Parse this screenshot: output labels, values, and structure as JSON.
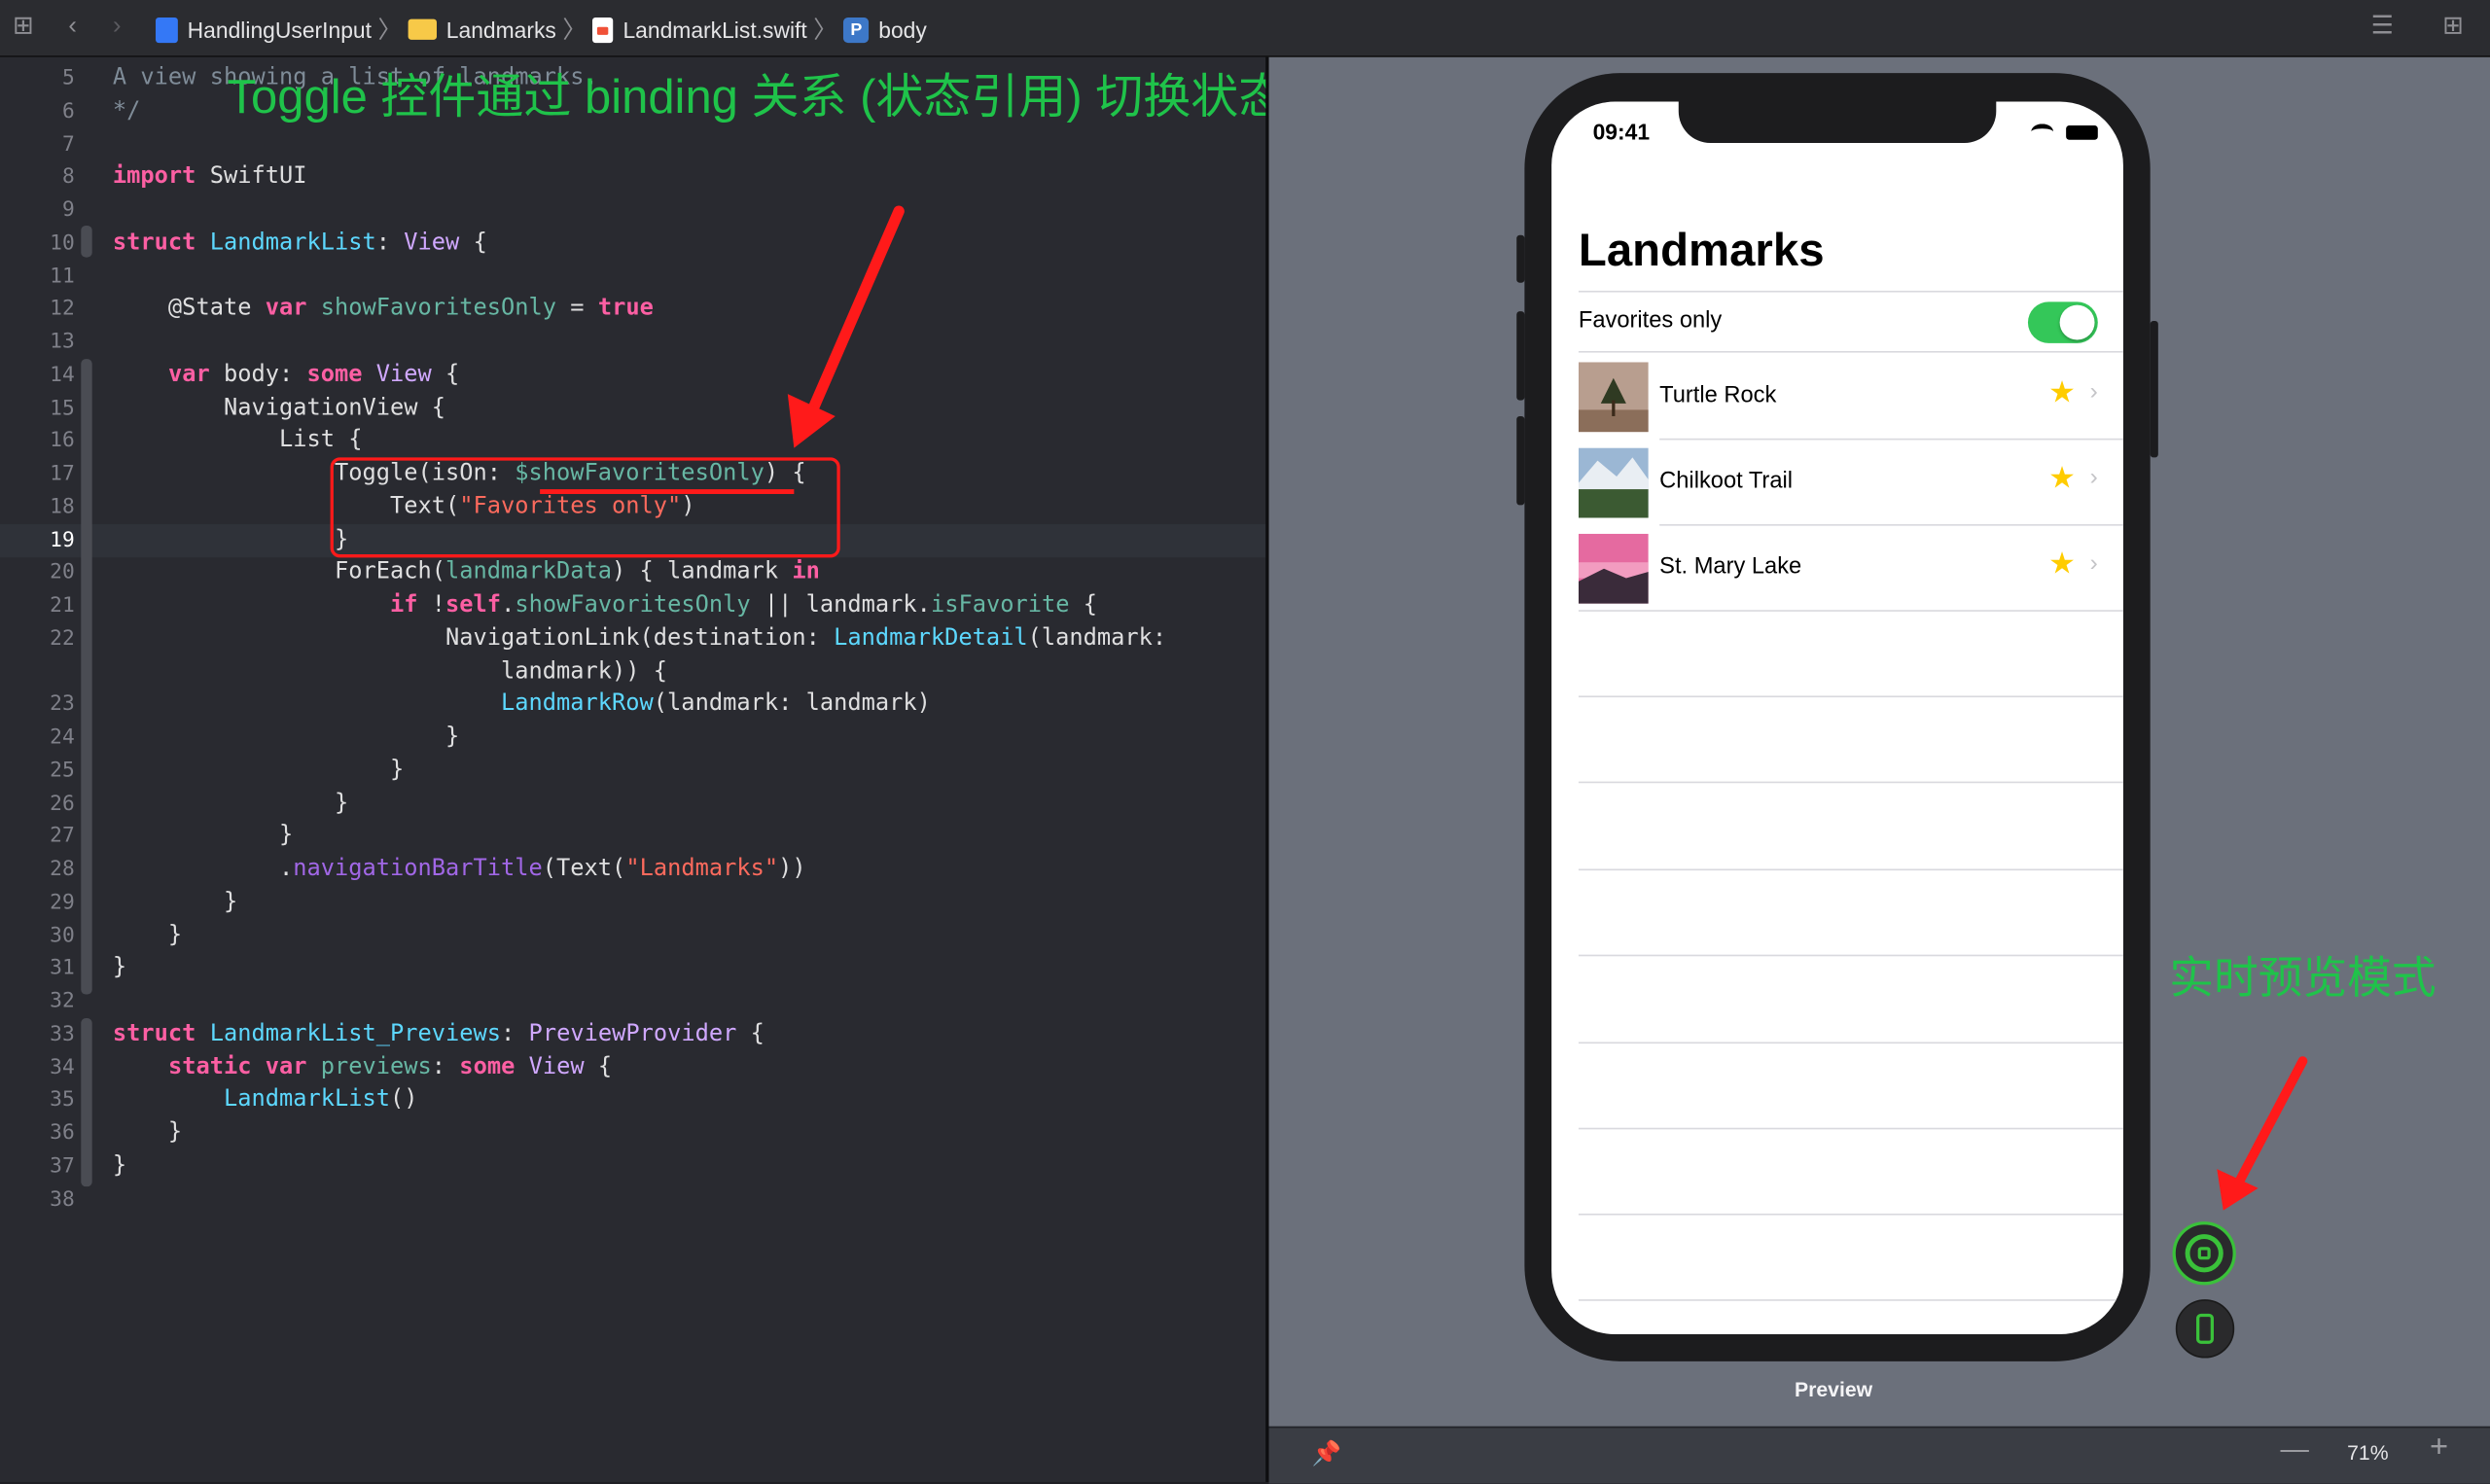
{
  "toolbar": {
    "grid_icon": "grid-icon",
    "back_icon": "chevron-left-icon",
    "forward_icon": "chevron-right-icon",
    "breadcrumbs": [
      {
        "label": "HandlingUserInput",
        "icon": "xcode-project-icon"
      },
      {
        "label": "Landmarks",
        "icon": "folder-icon"
      },
      {
        "label": "LandmarkList.swift",
        "icon": "swift-file-icon"
      },
      {
        "label": "body",
        "icon": "property-icon",
        "badge": "P"
      }
    ],
    "right_icons": [
      "editor-options-icon",
      "add-editor-icon"
    ]
  },
  "editor": {
    "annotation": "Toggle 控件通过 binding 关系 (状态引用) 切换状态",
    "current_line": "19",
    "lines": [
      {
        "n": "5",
        "text": "A view showing a list of landmarks."
      },
      {
        "n": "6",
        "text": "*/"
      },
      {
        "n": "7",
        "text": ""
      },
      {
        "n": "8",
        "text": "import SwiftUI"
      },
      {
        "n": "9",
        "text": ""
      },
      {
        "n": "10",
        "text": "struct LandmarkList: View {"
      },
      {
        "n": "11",
        "text": ""
      },
      {
        "n": "12",
        "text": "@State var showFavoritesOnly = true"
      },
      {
        "n": "13",
        "text": ""
      },
      {
        "n": "14",
        "text": "var body: some View {"
      },
      {
        "n": "15",
        "text": "NavigationView {"
      },
      {
        "n": "16",
        "text": "List {"
      },
      {
        "n": "17",
        "text": "Toggle(isOn: $showFavoritesOnly) {"
      },
      {
        "n": "18",
        "text": "Text(\"Favorites only\")"
      },
      {
        "n": "19",
        "text": "}"
      },
      {
        "n": "20",
        "text": "ForEach(landmarkData) { landmark in"
      },
      {
        "n": "21",
        "text": "if !self.showFavoritesOnly || landmark.isFavorite {"
      },
      {
        "n": "22",
        "text": "NavigationLink(destination: LandmarkDetail(landmark:"
      },
      {
        "n": "",
        "text": "landmark)) {"
      },
      {
        "n": "23",
        "text": "LandmarkRow(landmark: landmark)"
      },
      {
        "n": "24",
        "text": "}"
      },
      {
        "n": "25",
        "text": "}"
      },
      {
        "n": "26",
        "text": "}"
      },
      {
        "n": "27",
        "text": "}"
      },
      {
        "n": "28",
        "text": ".navigationBarTitle(Text(\"Landmarks\"))"
      },
      {
        "n": "29",
        "text": "}"
      },
      {
        "n": "30",
        "text": "}"
      },
      {
        "n": "31",
        "text": "}"
      },
      {
        "n": "32",
        "text": ""
      },
      {
        "n": "33",
        "text": "struct LandmarkList_Previews: PreviewProvider {"
      },
      {
        "n": "34",
        "text": "static var previews: some View {"
      },
      {
        "n": "35",
        "text": "LandmarkList()"
      },
      {
        "n": "36",
        "text": "}"
      },
      {
        "n": "37",
        "text": "}"
      },
      {
        "n": "38",
        "text": ""
      }
    ]
  },
  "preview": {
    "status_time": "09:41",
    "nav_title": "Landmarks",
    "toggle_label": "Favorites only",
    "toggle_on": true,
    "landmarks": [
      {
        "name": "Turtle Rock",
        "favorite": true
      },
      {
        "name": "Chilkoot Trail",
        "favorite": true
      },
      {
        "name": "St. Mary Lake",
        "favorite": true
      }
    ],
    "preview_label": "Preview",
    "live_annotation": "实时预览模式",
    "live_button_icon": "live-preview-icon",
    "device_button_icon": "device-preview-icon"
  },
  "bottombar": {
    "pin_icon": "pin-icon",
    "zoom": "71%",
    "zoom_out_icon": "minus-icon",
    "zoom_in_icon": "plus-icon"
  },
  "colors": {
    "annotation_green": "#1fc34a",
    "annotation_red": "#ff1a1a",
    "toggle_on": "#34c759",
    "star": "#ffcc00",
    "editor_bg": "#292a30"
  }
}
